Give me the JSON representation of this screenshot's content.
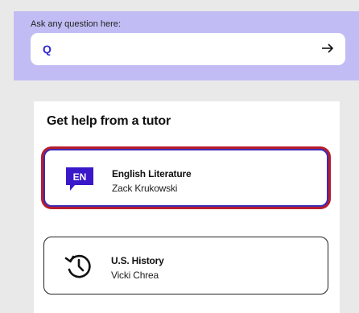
{
  "ask": {
    "label": "Ask any question here:",
    "input_prefix": "Q",
    "submit_icon": "arrow-right-icon"
  },
  "tutor_section": {
    "title": "Get help from a tutor",
    "cards": [
      {
        "badge": "EN",
        "badge_icon": "speech-bubble-icon",
        "subject": "English Literature",
        "tutor": "Zack Krukowski",
        "selected": true
      },
      {
        "badge_icon": "history-clock-icon",
        "subject": "U.S. History",
        "tutor": "Vicki Chrea",
        "selected": false
      }
    ]
  },
  "colors": {
    "ask_band": "#c1bdf4",
    "accent": "#2f25d8",
    "selection_ring": "#b81c2c",
    "badge_bg": "#3a18c9"
  }
}
